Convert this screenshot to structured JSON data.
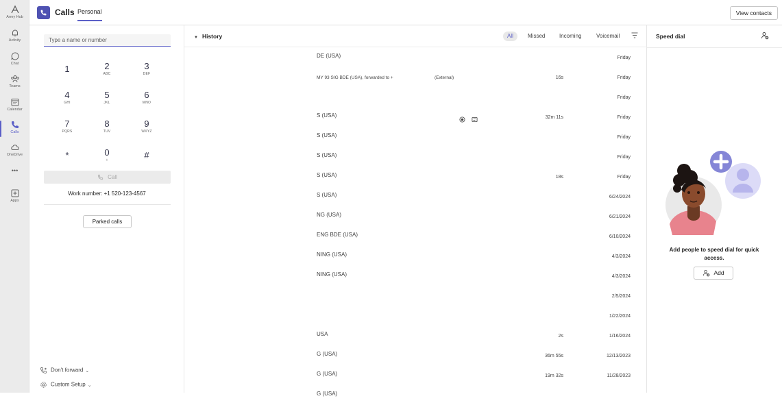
{
  "rail": {
    "items": [
      {
        "label": "Army Hub",
        "icon": "army-hub-icon"
      },
      {
        "label": "Activity",
        "icon": "bell-icon"
      },
      {
        "label": "Chat",
        "icon": "chat-icon"
      },
      {
        "label": "Teams",
        "icon": "teams-icon"
      },
      {
        "label": "Calendar",
        "icon": "calendar-icon"
      },
      {
        "label": "Calls",
        "icon": "phone-icon",
        "active": true
      },
      {
        "label": "OneDrive",
        "icon": "cloud-icon"
      },
      {
        "label": "•••",
        "icon": "more-icon"
      },
      {
        "label": "Apps",
        "icon": "add-apps-icon"
      }
    ]
  },
  "header": {
    "title": "Calls",
    "tab": "Personal",
    "view_contacts": "View contacts"
  },
  "dialpad": {
    "placeholder": "Type a name or number",
    "keys": [
      {
        "digit": "1",
        "letters": ""
      },
      {
        "digit": "2",
        "letters": "ABC"
      },
      {
        "digit": "3",
        "letters": "DEF"
      },
      {
        "digit": "4",
        "letters": "GHI"
      },
      {
        "digit": "5",
        "letters": "JKL"
      },
      {
        "digit": "6",
        "letters": "MNO"
      },
      {
        "digit": "7",
        "letters": "PQRS"
      },
      {
        "digit": "8",
        "letters": "TUV"
      },
      {
        "digit": "9",
        "letters": "WXYZ"
      },
      {
        "digit": "*",
        "letters": ""
      },
      {
        "digit": "0",
        "letters": "+"
      },
      {
        "digit": "#",
        "letters": ""
      }
    ],
    "call_label": "Call",
    "work_number": "Work number: +1 520-123-4567",
    "parked_calls": "Parked calls",
    "dont_forward": "Don't forward",
    "custom_setup": "Custom Setup"
  },
  "history": {
    "title": "History",
    "filters": [
      "All",
      "Missed",
      "Incoming",
      "Voicemail"
    ],
    "active_filter": "All",
    "rows": [
      {
        "name": "DE (USA)",
        "duration": "",
        "date": "Friday"
      },
      {
        "name": "MY 93 SIG BDE (USA), forwarded to +",
        "external": "(External)",
        "duration": "16s",
        "date": "Friday"
      },
      {
        "name": "",
        "duration": "",
        "date": "Friday"
      },
      {
        "name": "S (USA)",
        "duration": "32m 11s",
        "date": "Friday",
        "icons": true
      },
      {
        "name": "S (USA)",
        "duration": "",
        "date": "Friday"
      },
      {
        "name": "S (USA)",
        "duration": "",
        "date": "Friday"
      },
      {
        "name": "S (USA)",
        "duration": "18s",
        "date": "Friday"
      },
      {
        "name": "S (USA)",
        "duration": "",
        "date": "6/24/2024"
      },
      {
        "name": "NG (USA)",
        "duration": "",
        "date": "6/21/2024"
      },
      {
        "name": "ENG BDE (USA)",
        "duration": "",
        "date": "6/10/2024"
      },
      {
        "name": "NING (USA)",
        "duration": "",
        "date": "4/3/2024"
      },
      {
        "name": "NING (USA)",
        "duration": "",
        "date": "4/3/2024"
      },
      {
        "name": "",
        "duration": "",
        "date": "2/5/2024"
      },
      {
        "name": "",
        "duration": "",
        "date": "1/22/2024"
      },
      {
        "name": "USA",
        "duration": "2s",
        "date": "1/16/2024"
      },
      {
        "name": "G (USA)",
        "duration": "36m 55s",
        "date": "12/13/2023"
      },
      {
        "name": "G (USA)",
        "duration": "19m 32s",
        "date": "11/28/2023"
      },
      {
        "name": "G (USA)",
        "duration": "",
        "date": ""
      }
    ]
  },
  "speed_dial": {
    "title": "Speed dial",
    "message": "Add people to speed dial for quick access.",
    "add_label": "Add"
  },
  "colors": {
    "accent": "#5b5fc7",
    "rail_bg": "#ebebeb",
    "illustration_pink": "#e8838d",
    "illustration_lavender": "#c5c4ef"
  }
}
